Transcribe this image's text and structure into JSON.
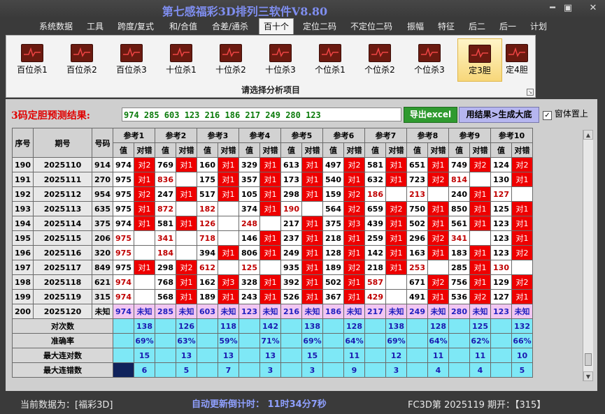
{
  "app_title": "第七感福彩3D排列三软件V8.80",
  "window_buttons": {
    "minimize": "━",
    "maximize": "▣",
    "close": "✕"
  },
  "menu": [
    "系统数据",
    "工具",
    "跨度/复式",
    "和/合值",
    "合差/通杀",
    "百十个",
    "定位二码",
    "不定位二码",
    "振幅",
    "特征",
    "后二",
    "后一",
    "计划"
  ],
  "active_menu": "百十个",
  "ribbon": {
    "buttons": [
      "百位杀1",
      "百位杀2",
      "百位杀3",
      "十位杀1",
      "十位杀2",
      "十位杀3",
      "个位杀1",
      "个位杀2",
      "个位杀3",
      "定3胆",
      "定4胆"
    ],
    "selected": "定3胆",
    "caption": "请选择分析项目"
  },
  "prediction": {
    "label": "3码定胆预测结果:",
    "value": "974  285  603  123  216  186  217  249  280  123",
    "export_label": "导出excel",
    "generate_label": "用结果>生成大底",
    "ontop_label": "窗体置上",
    "ontop_checked": true
  },
  "table": {
    "headers": {
      "index": "序号",
      "period": "期号",
      "number": "号码",
      "value": "值",
      "check": "对错"
    },
    "refs": [
      "参考1",
      "参考2",
      "参考3",
      "参考4",
      "参考5",
      "参考6",
      "参考7",
      "参考8",
      "参考9",
      "参考10"
    ],
    "rows": [
      {
        "idx": "190",
        "period": "2025110",
        "num": "914",
        "cells": [
          [
            "974",
            "对2",
            0
          ],
          [
            "769",
            "对1",
            0
          ],
          [
            "160",
            "对1",
            0
          ],
          [
            "329",
            "对1",
            0
          ],
          [
            "613",
            "对1",
            0
          ],
          [
            "497",
            "对2",
            0
          ],
          [
            "581",
            "对1",
            0
          ],
          [
            "651",
            "对1",
            0
          ],
          [
            "749",
            "对2",
            0
          ],
          [
            "124",
            "对2",
            0
          ]
        ]
      },
      {
        "idx": "191",
        "period": "2025111",
        "num": "270",
        "cells": [
          [
            "975",
            "对1",
            0
          ],
          [
            "836",
            "",
            1
          ],
          [
            "175",
            "对1",
            0
          ],
          [
            "357",
            "对1",
            0
          ],
          [
            "173",
            "对1",
            0
          ],
          [
            "540",
            "对1",
            0
          ],
          [
            "632",
            "对1",
            0
          ],
          [
            "723",
            "对2",
            0
          ],
          [
            "814",
            "",
            1
          ],
          [
            "130",
            "对1",
            0
          ]
        ]
      },
      {
        "idx": "192",
        "period": "2025112",
        "num": "954",
        "cells": [
          [
            "975",
            "对2",
            0
          ],
          [
            "247",
            "对1",
            0
          ],
          [
            "517",
            "对1",
            0
          ],
          [
            "105",
            "对1",
            0
          ],
          [
            "298",
            "对1",
            0
          ],
          [
            "159",
            "对2",
            0
          ],
          [
            "186",
            "",
            1
          ],
          [
            "213",
            "",
            1
          ],
          [
            "240",
            "对1",
            0
          ],
          [
            "127",
            "",
            1
          ]
        ]
      },
      {
        "idx": "193",
        "period": "2025113",
        "num": "635",
        "cells": [
          [
            "975",
            "对1",
            0
          ],
          [
            "872",
            "",
            1
          ],
          [
            "182",
            "",
            1
          ],
          [
            "374",
            "对1",
            0
          ],
          [
            "190",
            "",
            1
          ],
          [
            "564",
            "对2",
            0
          ],
          [
            "659",
            "对2",
            0
          ],
          [
            "750",
            "对1",
            0
          ],
          [
            "850",
            "对1",
            0
          ],
          [
            "125",
            "对1",
            0
          ]
        ]
      },
      {
        "idx": "194",
        "period": "2025114",
        "num": "375",
        "cells": [
          [
            "974",
            "对1",
            0
          ],
          [
            "581",
            "对1",
            0
          ],
          [
            "126",
            "",
            1
          ],
          [
            "248",
            "",
            1
          ],
          [
            "217",
            "对1",
            0
          ],
          [
            "375",
            "对3",
            0
          ],
          [
            "439",
            "对1",
            0
          ],
          [
            "502",
            "对1",
            0
          ],
          [
            "561",
            "对1",
            0
          ],
          [
            "123",
            "对1",
            0
          ]
        ]
      },
      {
        "idx": "195",
        "period": "2025115",
        "num": "206",
        "cells": [
          [
            "975",
            "",
            1
          ],
          [
            "341",
            "",
            1
          ],
          [
            "718",
            "",
            1
          ],
          [
            "146",
            "对1",
            0
          ],
          [
            "237",
            "对1",
            0
          ],
          [
            "218",
            "对1",
            0
          ],
          [
            "259",
            "对1",
            0
          ],
          [
            "296",
            "对2",
            0
          ],
          [
            "341",
            "",
            1
          ],
          [
            "123",
            "对1",
            0
          ]
        ]
      },
      {
        "idx": "196",
        "period": "2025116",
        "num": "320",
        "cells": [
          [
            "975",
            "",
            1
          ],
          [
            "184",
            "",
            1
          ],
          [
            "394",
            "对1",
            0
          ],
          [
            "806",
            "对1",
            0
          ],
          [
            "249",
            "对1",
            0
          ],
          [
            "128",
            "对1",
            0
          ],
          [
            "142",
            "对1",
            0
          ],
          [
            "163",
            "对1",
            0
          ],
          [
            "183",
            "对1",
            0
          ],
          [
            "123",
            "对2",
            0
          ]
        ]
      },
      {
        "idx": "197",
        "period": "2025117",
        "num": "849",
        "cells": [
          [
            "975",
            "对1",
            0
          ],
          [
            "298",
            "对2",
            0
          ],
          [
            "612",
            "",
            1
          ],
          [
            "125",
            "",
            1
          ],
          [
            "935",
            "对1",
            0
          ],
          [
            "189",
            "对2",
            0
          ],
          [
            "218",
            "对1",
            0
          ],
          [
            "253",
            "",
            1
          ],
          [
            "285",
            "对1",
            0
          ],
          [
            "130",
            "",
            1
          ]
        ]
      },
      {
        "idx": "198",
        "period": "2025118",
        "num": "621",
        "cells": [
          [
            "974",
            "",
            1
          ],
          [
            "768",
            "对1",
            0
          ],
          [
            "162",
            "对3",
            0
          ],
          [
            "328",
            "对1",
            0
          ],
          [
            "392",
            "对1",
            0
          ],
          [
            "502",
            "对1",
            0
          ],
          [
            "587",
            "",
            1
          ],
          [
            "671",
            "对2",
            0
          ],
          [
            "756",
            "对1",
            0
          ],
          [
            "129",
            "对2",
            0
          ]
        ]
      },
      {
        "idx": "199",
        "period": "2025119",
        "num": "315",
        "cells": [
          [
            "974",
            "",
            1
          ],
          [
            "568",
            "对1",
            0
          ],
          [
            "189",
            "对1",
            0
          ],
          [
            "243",
            "对1",
            0
          ],
          [
            "526",
            "对1",
            0
          ],
          [
            "367",
            "对1",
            0
          ],
          [
            "429",
            "",
            1
          ],
          [
            "491",
            "对1",
            0
          ],
          [
            "536",
            "对2",
            0
          ],
          [
            "127",
            "对1",
            0
          ]
        ]
      }
    ],
    "future": {
      "idx": "200",
      "period": "2025120",
      "num": "未知",
      "values": [
        "974",
        "285",
        "603",
        "123",
        "216",
        "186",
        "217",
        "249",
        "280",
        "123"
      ],
      "check": "未知"
    },
    "stats": [
      {
        "label": "对次数",
        "values": [
          "138",
          "126",
          "118",
          "142",
          "138",
          "128",
          "138",
          "128",
          "125",
          "132"
        ]
      },
      {
        "label": "准确率",
        "values": [
          "69%",
          "63%",
          "59%",
          "71%",
          "69%",
          "64%",
          "69%",
          "64%",
          "62%",
          "66%"
        ]
      },
      {
        "label": "最大连对数",
        "values": [
          "15",
          "13",
          "13",
          "13",
          "15",
          "11",
          "12",
          "11",
          "11",
          "10"
        ]
      },
      {
        "label": "最大连错数",
        "values": [
          "6",
          "5",
          "7",
          "3",
          "3",
          "9",
          "3",
          "4",
          "4",
          "5"
        ]
      }
    ]
  },
  "status": {
    "current": "当前数据为：[福彩3D]",
    "countdown": "自动更新倒计时： 11时34分7秒",
    "draw": "FC3D第 2025119 期开：【315】"
  },
  "colors": {
    "hit": "#ee0000",
    "future_row": "#f2c6f2",
    "stat_row": "#7ee8f6",
    "excel_btn": "#2f9a2f",
    "generate_btn": "#b6b6f0"
  }
}
